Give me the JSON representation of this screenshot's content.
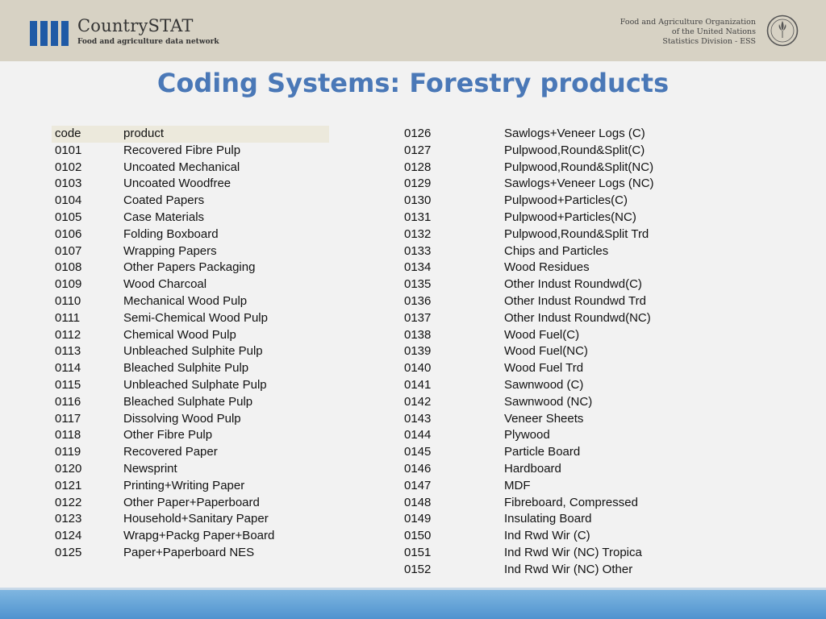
{
  "header": {
    "brand_name": "CountrySTAT",
    "brand_tagline": "Food and agriculture data network",
    "org_line1": "Food and Agriculture Organization",
    "org_line2": "of the United Nations",
    "org_line3": "Statistics Division - ESS",
    "fao_logo_text": "FAO",
    "fao_logo_motto": "FIAT PANIS"
  },
  "title": "Coding Systems: Forestry products",
  "table_header": {
    "code": "code",
    "product": "product"
  },
  "left_rows": [
    {
      "code": "0101",
      "product": "Recovered Fibre Pulp"
    },
    {
      "code": "0102",
      "product": "Uncoated Mechanical"
    },
    {
      "code": "0103",
      "product": "Uncoated Woodfree"
    },
    {
      "code": "0104",
      "product": "Coated Papers"
    },
    {
      "code": "0105",
      "product": "Case Materials"
    },
    {
      "code": "0106",
      "product": "Folding Boxboard"
    },
    {
      "code": "0107",
      "product": "Wrapping Papers"
    },
    {
      "code": "0108",
      "product": "Other Papers Packaging"
    },
    {
      "code": "0109",
      "product": "Wood Charcoal"
    },
    {
      "code": "0110",
      "product": "Mechanical Wood Pulp"
    },
    {
      "code": "0111",
      "product": "Semi-Chemical Wood Pulp"
    },
    {
      "code": "0112",
      "product": "Chemical Wood Pulp"
    },
    {
      "code": "0113",
      "product": "Unbleached Sulphite Pulp"
    },
    {
      "code": "0114",
      "product": "Bleached Sulphite Pulp"
    },
    {
      "code": "0115",
      "product": "Unbleached Sulphate Pulp"
    },
    {
      "code": "0116",
      "product": "Bleached Sulphate Pulp"
    },
    {
      "code": "0117",
      "product": "Dissolving Wood Pulp"
    },
    {
      "code": "0118",
      "product": "Other Fibre Pulp"
    },
    {
      "code": "0119",
      "product": "Recovered Paper"
    },
    {
      "code": "0120",
      "product": "Newsprint"
    },
    {
      "code": "0121",
      "product": "Printing+Writing Paper"
    },
    {
      "code": "0122",
      "product": "Other Paper+Paperboard"
    },
    {
      "code": "0123",
      "product": "Household+Sanitary Paper"
    },
    {
      "code": "0124",
      "product": "Wrapg+Packg Paper+Board"
    },
    {
      "code": "0125",
      "product": "Paper+Paperboard NES"
    }
  ],
  "right_rows": [
    {
      "code": "0126",
      "product": "Sawlogs+Veneer Logs (C)"
    },
    {
      "code": "0127",
      "product": "Pulpwood,Round&Split(C)"
    },
    {
      "code": "0128",
      "product": "Pulpwood,Round&Split(NC)"
    },
    {
      "code": "0129",
      "product": "Sawlogs+Veneer Logs (NC)"
    },
    {
      "code": "0130",
      "product": "Pulpwood+Particles(C)"
    },
    {
      "code": "0131",
      "product": "Pulpwood+Particles(NC)"
    },
    {
      "code": "0132",
      "product": "Pulpwood,Round&Split Trd"
    },
    {
      "code": "0133",
      "product": "Chips and Particles"
    },
    {
      "code": "0134",
      "product": "Wood Residues"
    },
    {
      "code": "0135",
      "product": "Other Indust Roundwd(C)"
    },
    {
      "code": "0136",
      "product": "Other Indust Roundwd Trd"
    },
    {
      "code": "0137",
      "product": "Other Indust Roundwd(NC)"
    },
    {
      "code": "0138",
      "product": "Wood Fuel(C)"
    },
    {
      "code": "0139",
      "product": "Wood Fuel(NC)"
    },
    {
      "code": "0140",
      "product": "Wood Fuel Trd"
    },
    {
      "code": "0141",
      "product": "Sawnwood (C)"
    },
    {
      "code": "0142",
      "product": "Sawnwood (NC)"
    },
    {
      "code": "0143",
      "product": "Veneer Sheets"
    },
    {
      "code": "0144",
      "product": "Plywood"
    },
    {
      "code": "0145",
      "product": "Particle Board"
    },
    {
      "code": "0146",
      "product": "Hardboard"
    },
    {
      "code": "0147",
      "product": "MDF"
    },
    {
      "code": "0148",
      "product": "Fibreboard, Compressed"
    },
    {
      "code": "0149",
      "product": "Insulating Board"
    },
    {
      "code": "0150",
      "product": "Ind Rwd Wir (C)"
    },
    {
      "code": "0151",
      "product": "Ind Rwd Wir (NC) Tropica"
    },
    {
      "code": "0152",
      "product": "Ind Rwd Wir (NC) Other"
    }
  ]
}
